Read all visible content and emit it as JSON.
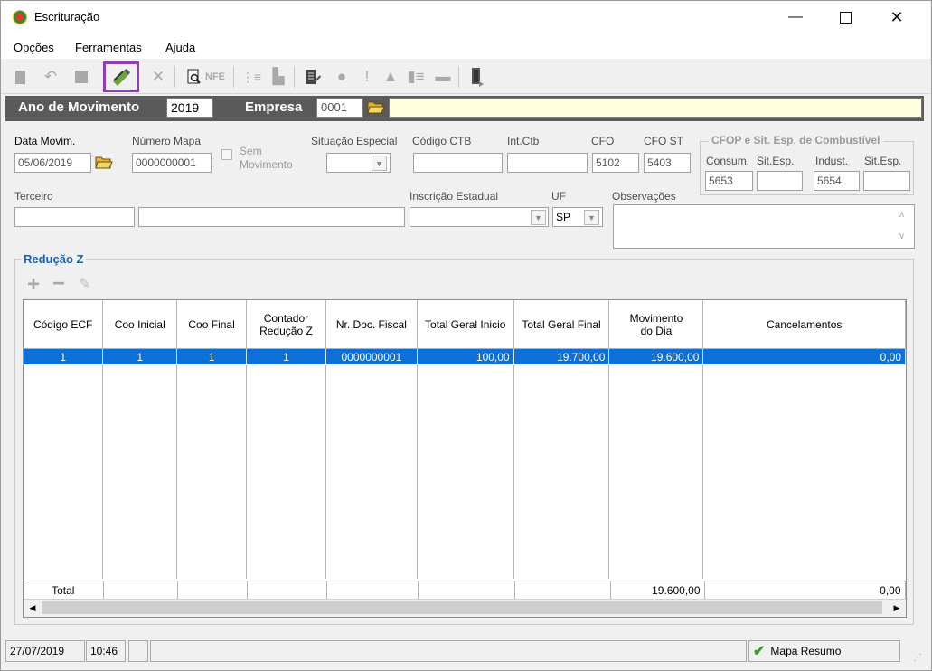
{
  "window": {
    "title": "Escrituração"
  },
  "menu": [
    "Opções",
    "Ferramentas",
    "Ajuda"
  ],
  "toolbar_icons": [
    "new-icon",
    "undo-icon",
    "stop-icon",
    "edit-icon",
    "delete-icon",
    "print-preview-icon",
    "nfe-icon",
    "tree-icon",
    "export-icon",
    "report-icon",
    "apple-icon",
    "pin-icon",
    "house-icon",
    "list-icon",
    "minus-icon",
    "exit-door-icon"
  ],
  "header": {
    "ano_label": "Ano de Movimento",
    "ano_value": "2019",
    "empresa_label": "Empresa",
    "empresa_value": "0001",
    "empresa_name": ""
  },
  "form": {
    "data_movim_label": "Data Movim.",
    "data_movim_value": "05/06/2019",
    "numero_mapa_label": "Número Mapa",
    "numero_mapa_value": "0000000001",
    "sem_movimento_label_1": "Sem",
    "sem_movimento_label_2": "Movimento",
    "situacao_label": "Situação Especial",
    "codigo_ctb_label": "Código CTB",
    "int_ctb_label": "Int.Ctb",
    "cfo_label": "CFO",
    "cfo_value": "5102",
    "cfo_st_label": "CFO ST",
    "cfo_st_value": "5403",
    "combustivel_group": "CFOP e Sit. Esp. de Combustível",
    "consum_label": "Consum.",
    "consum_value": "5653",
    "sit_esp_label_1": "Sit.Esp.",
    "indust_label": "Indust.",
    "indust_value": "5654",
    "sit_esp_label_2": "Sit.Esp.",
    "terceiro_label": "Terceiro",
    "inscricao_label": "Inscrição Estadual",
    "uf_label": "UF",
    "uf_value": "SP",
    "observacoes_label": "Observações"
  },
  "reducao": {
    "group_title": "Redução Z",
    "columns": [
      "Código ECF",
      "Coo Inicial",
      "Coo Final",
      "Contador Redução Z",
      "Nr. Doc. Fiscal",
      "Total Geral Inicio",
      "Total Geral Final",
      "Movimento do Dia",
      "Cancelamentos"
    ],
    "rows": [
      {
        "codigo_ecf": "1",
        "coo_inicial": "1",
        "coo_final": "1",
        "contador": "1",
        "nr_doc": "0000000001",
        "total_inicio": "100,00",
        "total_final": "19.700,00",
        "movimento": "19.600,00",
        "cancelamentos": "0,00"
      }
    ],
    "totals": {
      "label": "Total",
      "movimento": "19.600,00",
      "cancelamentos": "0,00"
    }
  },
  "status": {
    "date": "27/07/2019",
    "time": "10:46",
    "mapa_resumo": "Mapa Resumo"
  },
  "colors": {
    "selection": "#0e6fd7",
    "header_bar": "#5a5a5a",
    "yellow_field": "#ffffdf",
    "group_title": "#1a5fb4",
    "active_tool_border": "#8e3fb4"
  }
}
